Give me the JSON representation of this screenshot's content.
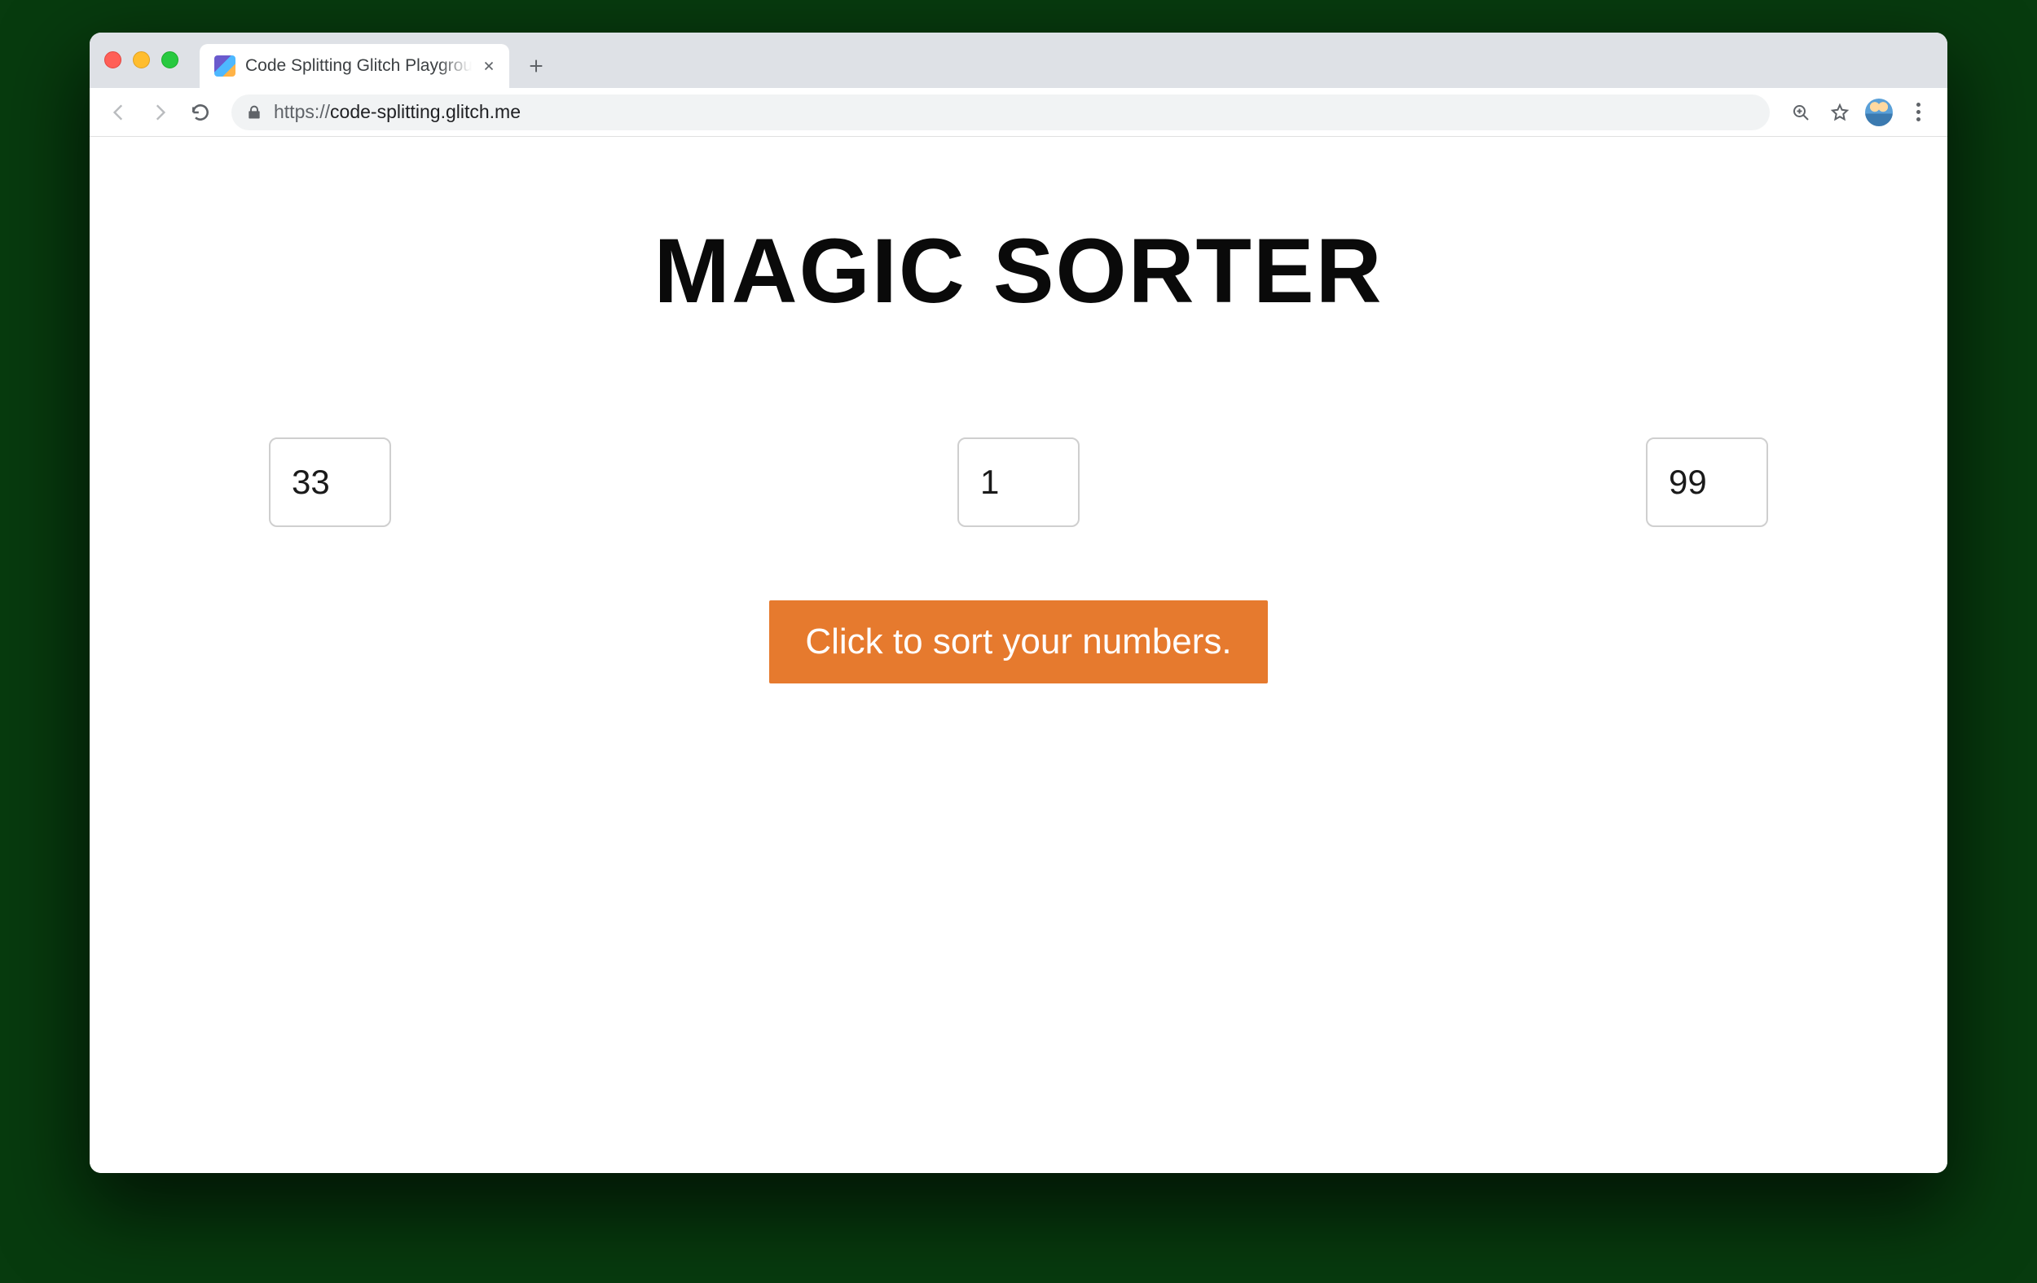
{
  "browser": {
    "tab_title": "Code Splitting Glitch Playground",
    "url_scheme": "https://",
    "url_host": "code-splitting.glitch.me",
    "url_path": ""
  },
  "page": {
    "title": "MAGIC SORTER",
    "inputs": {
      "a": "33",
      "b": "1",
      "c": "99"
    },
    "sort_button_label": "Click to sort your numbers."
  },
  "colors": {
    "accent": "#e67a2e"
  }
}
